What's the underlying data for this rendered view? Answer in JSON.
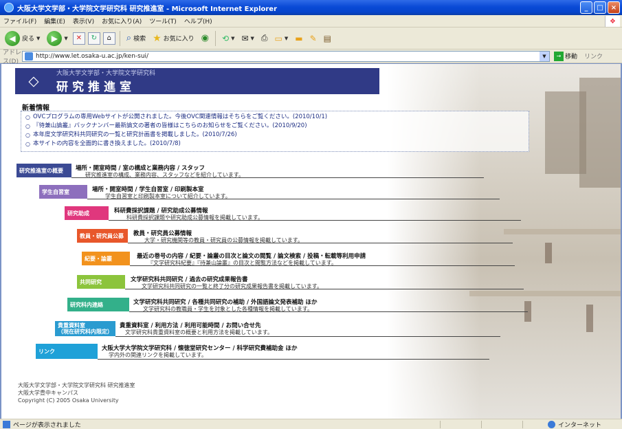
{
  "window": {
    "title": "大阪大学文学部・大学院文学研究科 研究推進室 - Microsoft Internet Explorer",
    "buttons": {
      "minimize": "_",
      "maximize": "□",
      "close": "×"
    }
  },
  "menu": {
    "items": [
      "ファイル(F)",
      "編集(E)",
      "表示(V)",
      "お気に入り(A)",
      "ツール(T)",
      "ヘルプ(H)"
    ]
  },
  "toolbar": {
    "back_label": "戻る",
    "search_label": "検索",
    "favorites_label": "お気に入り"
  },
  "address": {
    "label": "アドレス(D)",
    "url": "http://www.let.osaka-u.ac.jp/ken-sui/",
    "go_label": "移動",
    "links_label": "リンク"
  },
  "page": {
    "header": {
      "subtitle": "大阪大学文学部・大学院文学研究科",
      "title": "研究推進室"
    },
    "news": {
      "title": "新着情報",
      "items": [
        "OVCプログラムの専用Webサイトが公開されました。今後OVC関連情報はそちらをご覧ください。(2010/10/1)",
        "『待兼山論叢』バックナンバー最新論文の著者の皆様はこちらのお知らせをご覧ください。(2010/9/20)",
        "本年度文学研究科共同研究の一覧と研究計画書を掲載しました。(2010/7/26)",
        "本サイトの内容を全面的に書き換えました。(2010/7/8)"
      ]
    },
    "sections": [
      {
        "tab": "研究推進室の概要",
        "title": "場所・開室時間 / 室の構成と業務内容 / スタッフ",
        "desc": "研究推進室の構成、業務内容、スタッフなどを紹介しています。",
        "color": "#3b4a94"
      },
      {
        "tab": "学生自習室",
        "title": "場所・開室時間 / 学生自習室 / 印刷製本室",
        "desc": "学生自習室と印刷製本室について紹介しています。",
        "color": "#8d6fbd"
      },
      {
        "tab": "研究助成",
        "title": "科研費採択課題 / 研究助成公募情報",
        "desc": "科研費採択課題や研究助成公募情報を掲載しています。",
        "color": "#e0377d"
      },
      {
        "tab": "教員・研究員公募",
        "title": "教員・研究員公募情報",
        "desc": "大学・研究機関等の教員・研究員の公募情報を掲載しています。",
        "color": "#e8572b"
      },
      {
        "tab": "紀要・論叢",
        "title": "最近の巻号の内容 / 紀要・論叢の目次と論文の閲覧 / 論文検索 / 投稿・転載等利用申請",
        "desc": "『文学研究科紀要』『待兼山論叢』の目次と閲覧方法などを掲載しています。",
        "color": "#f2921d"
      },
      {
        "tab": "共同研究",
        "title": "文学研究科共同研究 / 過去の研究成果報告書",
        "desc": "文学研究科共同研究の一覧と終了分の研究成果報告書を掲載しています。",
        "color": "#8cc43c"
      },
      {
        "tab": "研究科内連絡",
        "title": "文学研究科共同研究 / 各種共同研究の補助 / 外国語論文発表補助 ほか",
        "desc": "文学研究科の教職員・学生を対象とした各種情報を掲載しています。",
        "color": "#33b08a"
      },
      {
        "tab": "貴重資料室\n（現在研究科内限定）",
        "title": "貴重資料室 / 利用方法 / 利用可能時間 / お問い合せ先",
        "desc": "文学研究科貴重資料室の概要と利用方法を掲載しています。",
        "color": "#2a9bd0"
      },
      {
        "tab": "リンク",
        "title": "大阪大学大学院文学研究科 / 懐徳堂研究センター / 科学研究費補助金 ほか",
        "desc": "学内外の関連リンクを掲載しています。",
        "color": "#1fa1d8"
      }
    ],
    "footer": {
      "line1": "大阪大学文学部・大学院文学研究科 研究推進室",
      "line2": "大阪大学豊中キャンパス",
      "line3": "Copyright (C) 2005 Osaka University"
    }
  },
  "status": {
    "text": "ページが表示されました",
    "zone": "インターネット"
  }
}
